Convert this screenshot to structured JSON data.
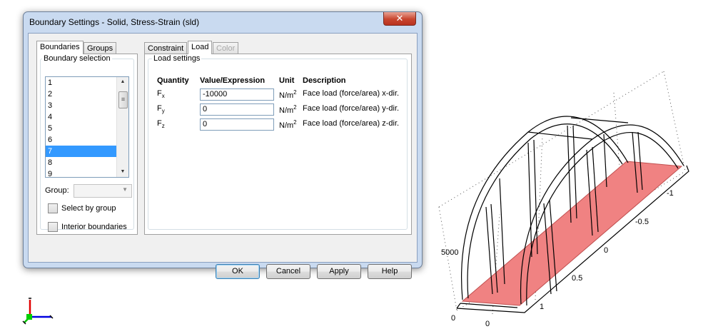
{
  "dialog": {
    "title": "Boundary Settings - Solid, Stress-Strain (sld)",
    "close_glyph": "✕"
  },
  "left_tabs": [
    {
      "label": "Boundaries",
      "active": true
    },
    {
      "label": "Groups",
      "active": false
    }
  ],
  "boundary_selection": {
    "label": "Boundary selection",
    "items": [
      "1",
      "2",
      "3",
      "4",
      "5",
      "6",
      "7",
      "8",
      "9"
    ],
    "selected": "7"
  },
  "group": {
    "label": "Group:",
    "value": ""
  },
  "checkboxes": {
    "select_by_group": {
      "label": "Select by group",
      "checked": false
    },
    "interior_boundaries": {
      "label": "Interior boundaries",
      "checked": false
    }
  },
  "right_tabs": [
    {
      "label": "Constraint",
      "state": "normal"
    },
    {
      "label": "Load",
      "state": "active"
    },
    {
      "label": "Color",
      "state": "disabled"
    }
  ],
  "load_settings": {
    "label": "Load settings",
    "headers": {
      "quantity": "Quantity",
      "value": "Value/Expression",
      "unit": "Unit",
      "description": "Description"
    },
    "rows": [
      {
        "q": "F",
        "sub": "x",
        "value": "-10000",
        "unit": "N/m",
        "unit_exp": "2",
        "description": "Face load (force/area) x-dir."
      },
      {
        "q": "F",
        "sub": "y",
        "value": "0",
        "unit": "N/m",
        "unit_exp": "2",
        "description": "Face load (force/area) y-dir."
      },
      {
        "q": "F",
        "sub": "z",
        "value": "0",
        "unit": "N/m",
        "unit_exp": "2",
        "description": "Face load (force/area) z-dir."
      }
    ]
  },
  "buttons": {
    "ok": "OK",
    "cancel": "Cancel",
    "apply": "Apply",
    "help": "Help"
  },
  "view3d": {
    "tick_labels": [
      "-1",
      "-0.5",
      "0",
      "0.5",
      "1",
      "5000",
      "0",
      "0"
    ],
    "face_color": "#f08080"
  }
}
